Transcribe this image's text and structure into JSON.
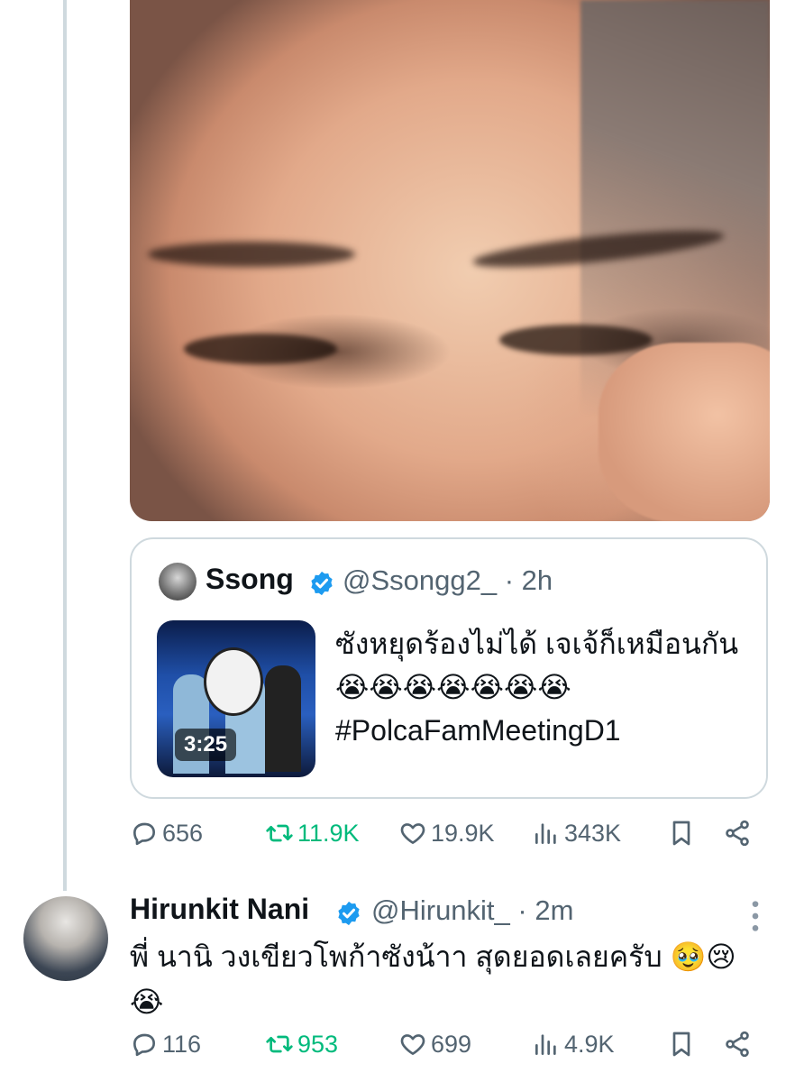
{
  "quoted": {
    "name": "Ssong",
    "handle_time": "@Ssongg2_ · 2h",
    "text": "ซังหยุดร้องไม่ได้ เจเจ้ก็เหมือนกัน😭😭😭😭😭😭😭 #PolcaFamMeetingD1",
    "video_duration": "3:25"
  },
  "post_actions": {
    "replies": "656",
    "reposts": "11.9K",
    "likes": "19.9K",
    "views": "343K"
  },
  "reply": {
    "name": "Hirunkit Nani",
    "handle_time": "@Hirunkit_ · 2m",
    "text": "พี่ นานิ วงเขียวโพก้าซังน้าา สุดยอดเลยครับ 🥹😢😭",
    "actions": {
      "replies": "116",
      "reposts": "953",
      "likes": "699",
      "views": "4.9K"
    }
  },
  "colors": {
    "text": "#0f1419",
    "secondary": "#536471",
    "repost_active": "#00ba7c",
    "verified": "#1d9bf0",
    "border": "#cfd9de"
  },
  "icons": [
    "reply-icon",
    "repost-icon",
    "like-icon",
    "views-icon",
    "bookmark-icon",
    "share-icon",
    "verified-icon",
    "more-icon"
  ]
}
